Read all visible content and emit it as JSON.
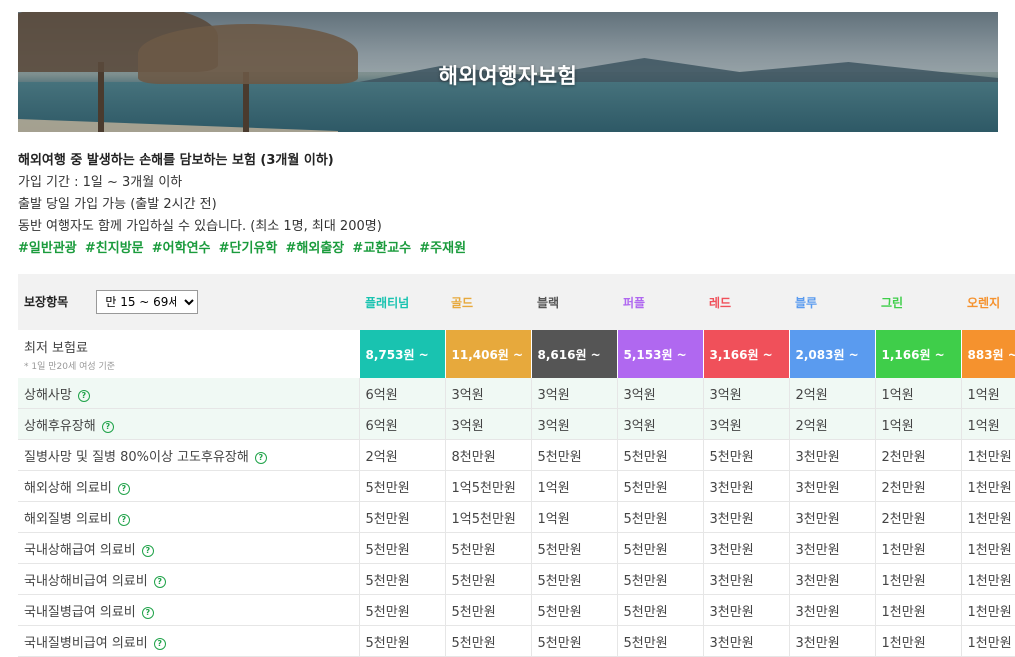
{
  "banner": {
    "title": "해외여행자보험"
  },
  "intro": {
    "lead": "해외여행 중 발생하는 손해를 담보하는 보험 (3개월 이하)",
    "lines": [
      "가입 기간 : 1일 ~ 3개월 이하",
      "출발 당일 가입 가능 (출발 2시간 전)",
      "동반 여행자도 함께 가입하실 수 있습니다. (최소 1명, 최대 200명)"
    ],
    "tags": [
      "#일반관광",
      "#친지방문",
      "#어학연수",
      "#단기유학",
      "#해외출장",
      "#교환교수",
      "#주재원"
    ]
  },
  "table": {
    "header_label": "보장항목",
    "age_select": "만 15 ~ 69세",
    "plans": [
      {
        "name": "플래티넘",
        "color": "#19c3b0",
        "price": "8,753원 ~"
      },
      {
        "name": "골드",
        "color": "#e7a93c",
        "price": "11,406원 ~"
      },
      {
        "name": "블랙",
        "color": "#555555",
        "price": "8,616원 ~"
      },
      {
        "name": "퍼플",
        "color": "#b068f0",
        "price": "5,153원 ~"
      },
      {
        "name": "레드",
        "color": "#f0505a",
        "price": "3,166원 ~"
      },
      {
        "name": "블루",
        "color": "#5a9bef",
        "price": "2,083원 ~"
      },
      {
        "name": "그린",
        "color": "#3fce4a",
        "price": "1,166원 ~"
      },
      {
        "name": "오렌지",
        "color": "#f5922e",
        "price": "883원 ~"
      }
    ],
    "premium_label": "최저 보험료",
    "premium_note": "* 1일 만20세 여성 기준",
    "rows": [
      {
        "label": "상해사망",
        "hl": true,
        "values": [
          "6억원",
          "3억원",
          "3억원",
          "3억원",
          "3억원",
          "2억원",
          "1억원",
          "1억원"
        ]
      },
      {
        "label": "상해후유장해",
        "hl": true,
        "values": [
          "6억원",
          "3억원",
          "3억원",
          "3억원",
          "3억원",
          "2억원",
          "1억원",
          "1억원"
        ]
      },
      {
        "label": "질병사망 및 질병 80%이상 고도후유장해",
        "hl": false,
        "values": [
          "2억원",
          "8천만원",
          "5천만원",
          "5천만원",
          "5천만원",
          "3천만원",
          "2천만원",
          "1천만원"
        ]
      },
      {
        "label": "해외상해 의료비",
        "hl": false,
        "values": [
          "5천만원",
          "1억5천만원",
          "1억원",
          "5천만원",
          "3천만원",
          "3천만원",
          "2천만원",
          "1천만원"
        ]
      },
      {
        "label": "해외질병 의료비",
        "hl": false,
        "values": [
          "5천만원",
          "1억5천만원",
          "1억원",
          "5천만원",
          "3천만원",
          "3천만원",
          "2천만원",
          "1천만원"
        ]
      },
      {
        "label": "국내상해급여 의료비",
        "hl": false,
        "values": [
          "5천만원",
          "5천만원",
          "5천만원",
          "5천만원",
          "3천만원",
          "3천만원",
          "1천만원",
          "1천만원"
        ]
      },
      {
        "label": "국내상해비급여 의료비",
        "hl": false,
        "values": [
          "5천만원",
          "5천만원",
          "5천만원",
          "5천만원",
          "3천만원",
          "3천만원",
          "1천만원",
          "1천만원"
        ]
      },
      {
        "label": "국내질병급여 의료비",
        "hl": false,
        "values": [
          "5천만원",
          "5천만원",
          "5천만원",
          "5천만원",
          "3천만원",
          "3천만원",
          "1천만원",
          "1천만원"
        ]
      },
      {
        "label": "국내질병비급여 의료비",
        "hl": false,
        "values": [
          "5천만원",
          "5천만원",
          "5천만원",
          "5천만원",
          "3천만원",
          "3천만원",
          "1천만원",
          "1천만원"
        ]
      }
    ],
    "help_icon": "question-circle-icon"
  }
}
